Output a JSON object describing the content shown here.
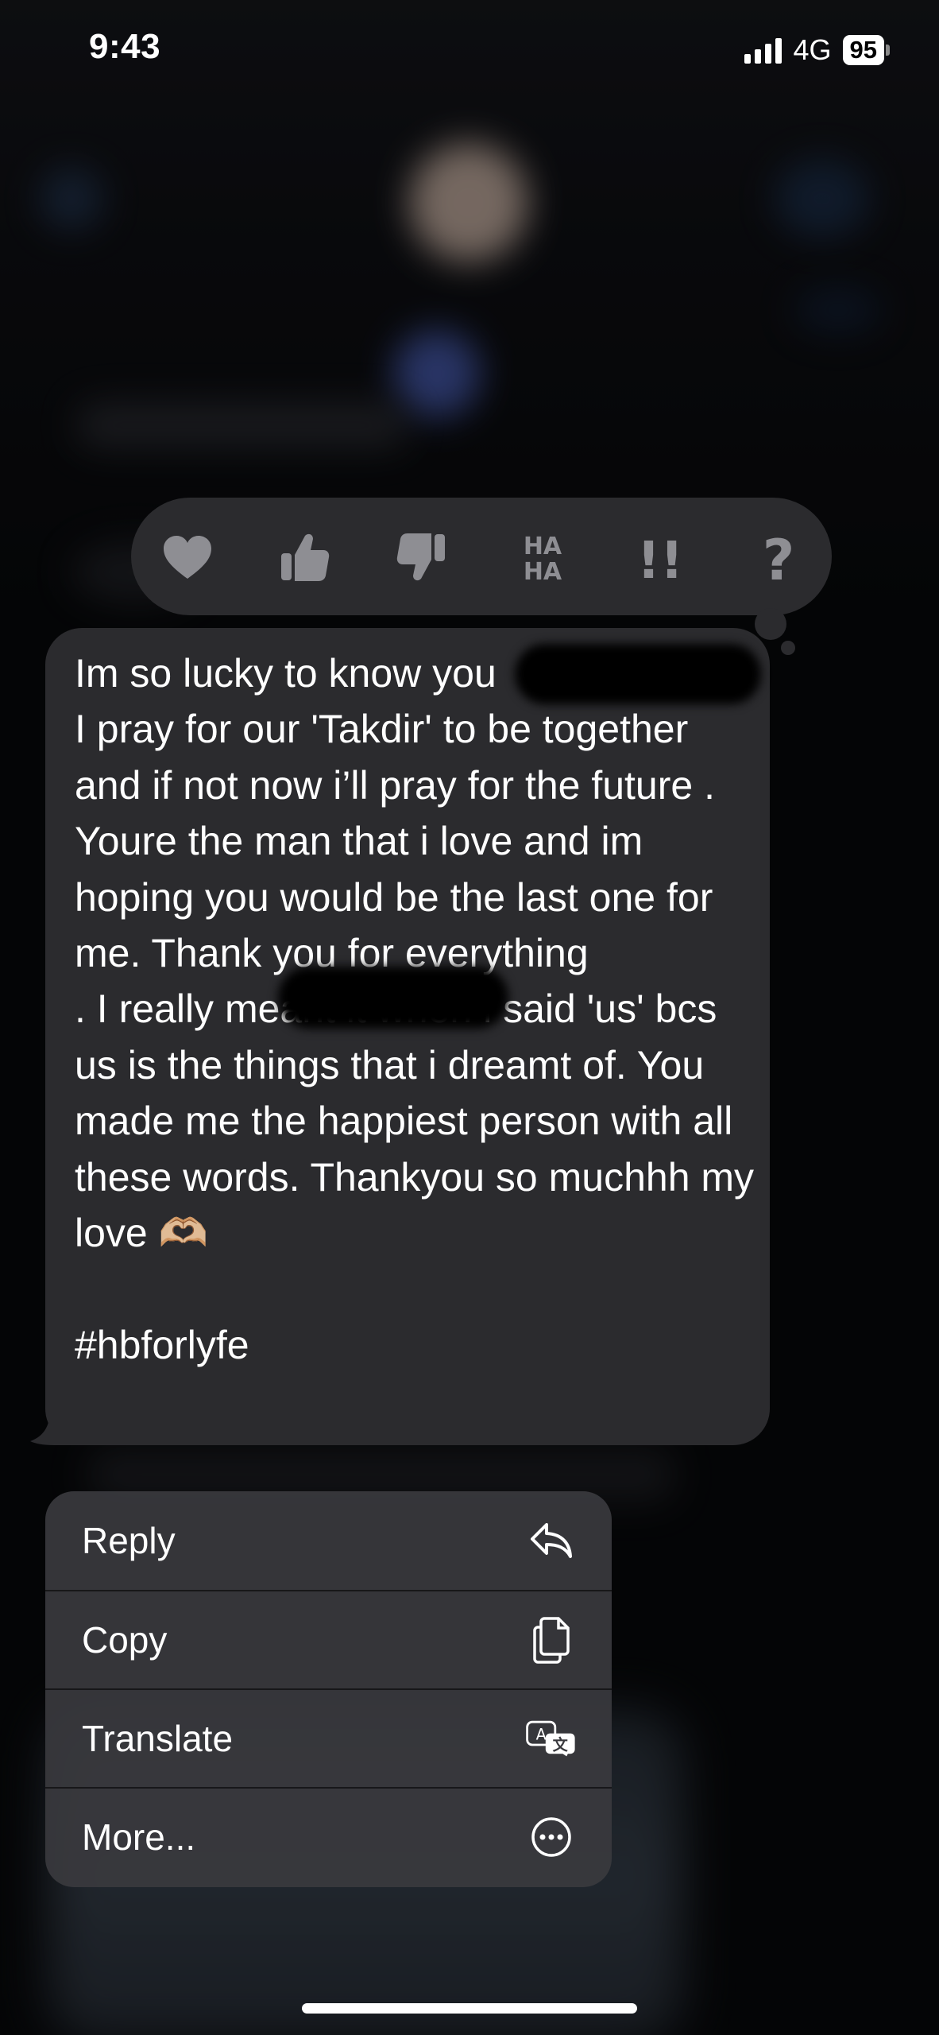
{
  "status_bar": {
    "time": "9:43",
    "network": "4G",
    "battery": "95"
  },
  "tapbacks": [
    {
      "name": "heart",
      "icon": "heart-icon"
    },
    {
      "name": "thumbs-up",
      "icon": "thumbs-up-icon"
    },
    {
      "name": "thumbs-down",
      "icon": "thumbs-down-icon"
    },
    {
      "name": "haha",
      "icon": "haha-icon",
      "text_top": "HA",
      "text_bottom": "HA"
    },
    {
      "name": "emphasize",
      "icon": "double-exclamation-icon",
      "text": "!!"
    },
    {
      "name": "question",
      "icon": "question-mark-icon",
      "text": "?"
    }
  ],
  "message": {
    "text": "Im so lucky to know you\nI pray for our 'Takdir' to be together and if not now i’ll pray for the future . Youre the man that i love and im hoping you would be the last one for me. Thank you for everything               . I really meant it when i said 'us' bcs us is the things that i dreamt of. You made me the happiest person with all these words. Thankyou so muchhh my love 🫶🏼\n\n#hbforlyfe"
  },
  "context_menu": {
    "items": [
      {
        "label": "Reply",
        "icon": "reply-arrow-icon"
      },
      {
        "label": "Copy",
        "icon": "copy-documents-icon"
      },
      {
        "label": "Translate",
        "icon": "translate-icon"
      },
      {
        "label": "More...",
        "icon": "more-ellipsis-icon"
      }
    ]
  },
  "colors": {
    "bubble": "#2b2b2e",
    "menu": "#3a3a3e",
    "tapback_icon": "#8e8e93"
  }
}
